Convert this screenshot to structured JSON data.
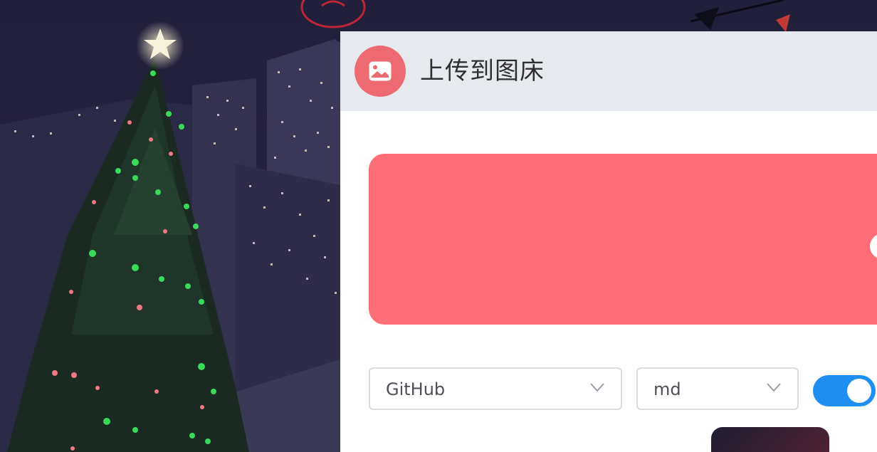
{
  "window": {
    "title": "上传到图床"
  },
  "controls": {
    "uploader_value": "GitHub",
    "format_value": "md",
    "auto_copy_on": true
  },
  "icons": {
    "header": "image-icon",
    "dropdown": "chevron-down-icon"
  },
  "colors": {
    "accent": "#ed6a70",
    "dropzone": "#ff6e77",
    "toggle_on": "#1f8ef1",
    "header_bg": "#e6e9ed"
  }
}
